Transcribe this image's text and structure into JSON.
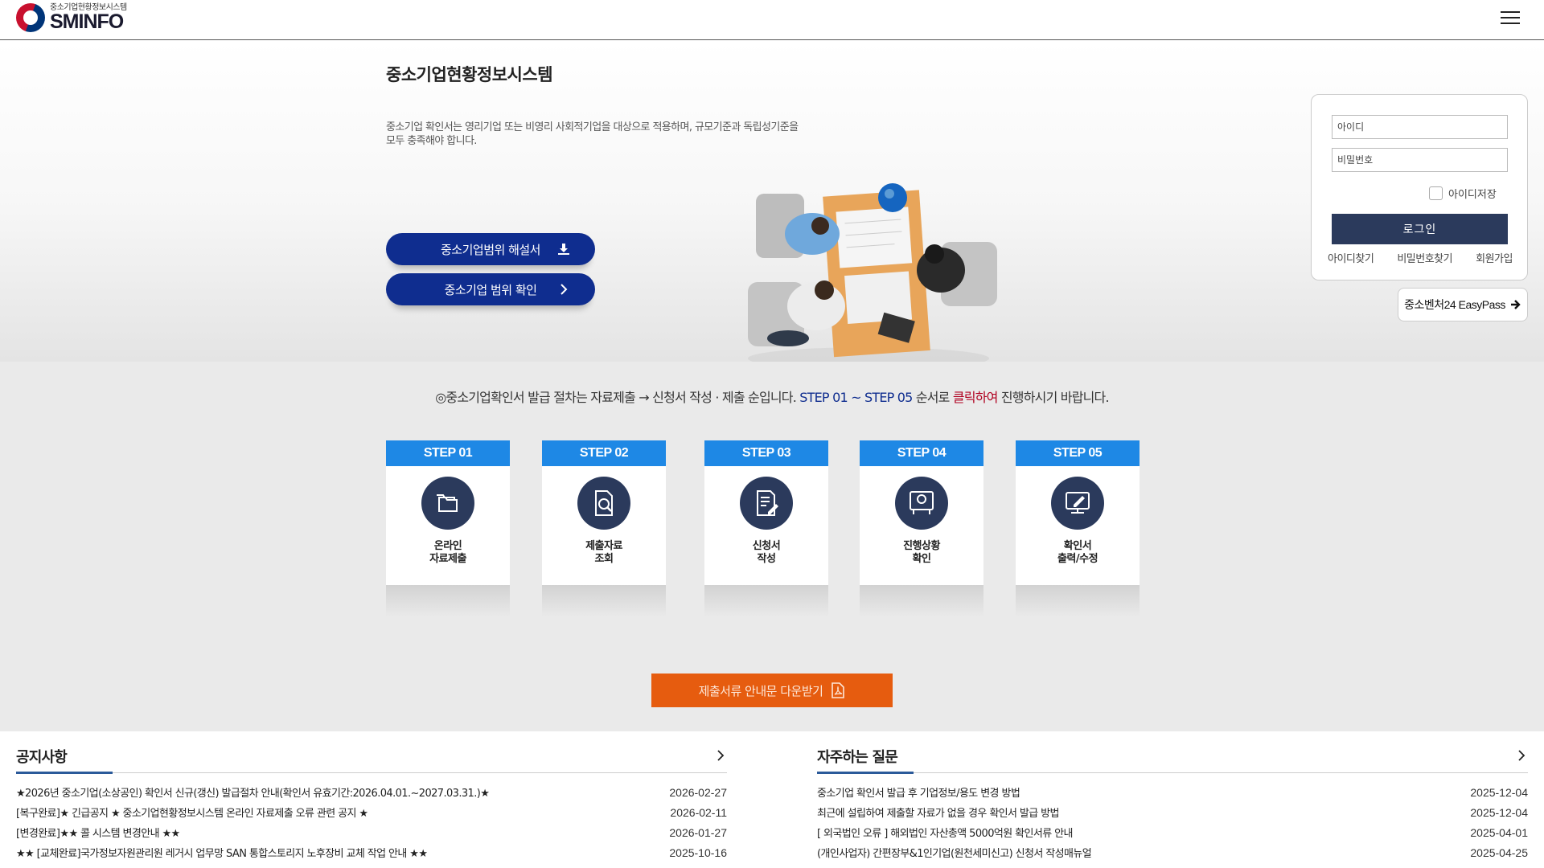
{
  "header": {
    "logo_sub": "중소기업현황정보시스템",
    "logo_main": "SMINFO"
  },
  "hero": {
    "title": "중소기업현황정보시스템",
    "description": "중소기업 확인서는 영리기업 또는 비영리 사회적기업을 대상으로 적용하며, 규모기준과 독립성기준을 모두 충족해야 합니다.",
    "btn_guide": "중소기업범위 해설서",
    "btn_check": "중소기업 범위 확인"
  },
  "login": {
    "id_placeholder": "아이디",
    "pw_placeholder": "비밀번호",
    "save_id": "아이디저장",
    "login_btn": "로그인",
    "find_id": "아이디찾기",
    "find_pw": "비밀번호찾기",
    "signup": "회원가입",
    "easypass": "중소벤처24 EasyPass"
  },
  "steps_note": {
    "prefix": "◎중소기업확인서 발급 절차는 자료제출 → 신청서 작성 · 제출 순입니다.",
    "range": "STEP 01 ~ STEP 05",
    "middle": "순서로",
    "click": "클릭하여",
    "suffix": "진행하시기 바랍니다."
  },
  "steps": [
    {
      "head": "STEP 01",
      "line1": "온라인",
      "line2": "자료제출",
      "icon": "folder-icon"
    },
    {
      "head": "STEP 02",
      "line1": "제출자료",
      "line2": "조회",
      "icon": "document-search-icon"
    },
    {
      "head": "STEP 03",
      "line1": "신청서",
      "line2": "작성",
      "icon": "document-edit-icon"
    },
    {
      "head": "STEP 04",
      "line1": "진행상황",
      "line2": "확인",
      "icon": "monitor-user-icon"
    },
    {
      "head": "STEP 05",
      "line1": "확인서",
      "line2": "출력/수정",
      "icon": "monitor-pen-icon"
    }
  ],
  "download_btn": "제출서류 안내문 다운받기",
  "notice": {
    "title": "공지사항",
    "items": [
      {
        "title": "★2026년 중소기업(소상공인) 확인서 신규(갱신) 발급절차 안내(확인서 유효기간:2026.04.01.~2027.03.31.)★",
        "date": "2026-02-27"
      },
      {
        "title": "[복구완료]★ 긴급공지 ★ 중소기업현황정보시스템 온라인 자료제출 오류 관련 공지 ★",
        "date": "2026-02-11"
      },
      {
        "title": "[변경완료]★★ 콜 시스템 변경안내 ★★",
        "date": "2026-01-27"
      },
      {
        "title": "★★ [교체완료]국가정보자원관리원 레거시 업무망 SAN 통합스토리지 노후장비 교체 작업 안내 ★★",
        "date": "2025-10-16"
      }
    ]
  },
  "faq": {
    "title": "자주하는 질문",
    "items": [
      {
        "title": "중소기업 확인서 발급 후 기업정보/용도 변경 방법",
        "date": "2025-12-04"
      },
      {
        "title": "최근에 설립하여 제출할 자료가 없을 경우 확인서 발급 방법",
        "date": "2025-12-04"
      },
      {
        "title": "[ 외국법인 오류 ] 해외법인 자산총액 5000억원 확인서류 안내",
        "date": "2025-04-01"
      },
      {
        "title": "(개인사업자) 간편장부&1인기업(원천세미신고) 신청서 작성매뉴얼",
        "date": "2025-04-25"
      }
    ]
  },
  "colors": {
    "navy_button": "#0f2d8f",
    "login_button": "#2b3a5c",
    "step_header": "#1e88e5",
    "download_button": "#e65c0f",
    "highlight_red": "#b00020"
  }
}
